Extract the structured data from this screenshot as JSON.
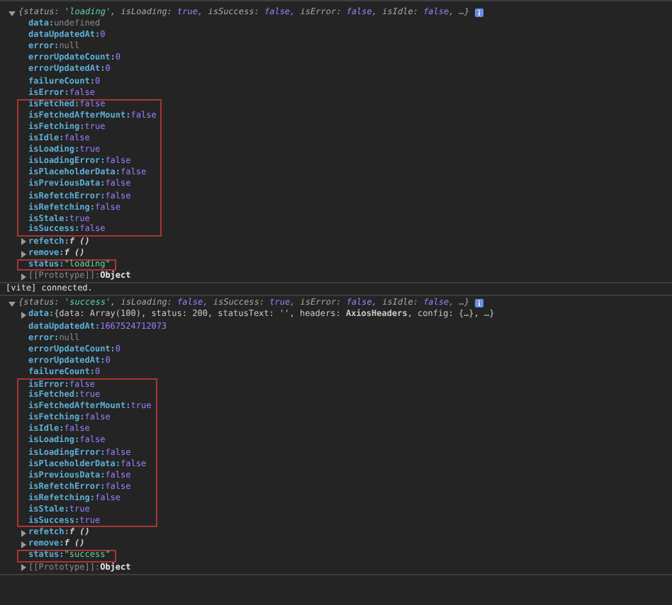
{
  "console": [
    {
      "kind": "object",
      "expanded": true,
      "summary": {
        "open": "{",
        "items": [
          {
            "key": "status:",
            "value": "'loading',",
            "kind": "string"
          },
          {
            "key": "isLoading:",
            "value": "true,",
            "kind": "boolean"
          },
          {
            "key": "isSuccess:",
            "value": "false,",
            "kind": "boolean"
          },
          {
            "key": "isError:",
            "value": "false,",
            "kind": "boolean"
          },
          {
            "key": "isIdle:",
            "value": "false,",
            "kind": "boolean"
          }
        ],
        "close": "…}"
      },
      "rows": [
        {
          "kind": "undefined",
          "key": "data:",
          "value": "undefined",
          "highlighted": false
        },
        {
          "kind": "number",
          "key": "dataUpdatedAt:",
          "value": "0",
          "highlighted": false
        },
        {
          "kind": "null",
          "key": "error:",
          "value": "null",
          "highlighted": false
        },
        {
          "kind": "number",
          "key": "errorUpdateCount:",
          "value": "0",
          "highlighted": false
        },
        {
          "kind": "number",
          "key": "errorUpdatedAt:",
          "value": "0",
          "highlighted": false
        },
        {
          "kind": "number",
          "key": "failureCount:",
          "value": "0",
          "highlighted": false
        },
        {
          "kind": "boolean",
          "key": "isError:",
          "value": "false",
          "highlighted": false
        },
        {
          "kind": "boolean",
          "key": "isFetched:",
          "value": "false",
          "highlighted": true
        },
        {
          "kind": "boolean",
          "key": "isFetchedAfterMount:",
          "value": "false",
          "highlighted": true
        },
        {
          "kind": "boolean",
          "key": "isFetching:",
          "value": "true",
          "highlighted": true
        },
        {
          "kind": "boolean",
          "key": "isIdle:",
          "value": "false",
          "highlighted": true
        },
        {
          "kind": "boolean",
          "key": "isLoading:",
          "value": "true",
          "highlighted": true
        },
        {
          "kind": "boolean",
          "key": "isLoadingError:",
          "value": "false",
          "highlighted": true
        },
        {
          "kind": "boolean",
          "key": "isPlaceholderData:",
          "value": "false",
          "highlighted": true
        },
        {
          "kind": "boolean",
          "key": "isPreviousData:",
          "value": "false",
          "highlighted": true
        },
        {
          "kind": "boolean",
          "key": "isRefetchError:",
          "value": "false",
          "highlighted": true
        },
        {
          "kind": "boolean",
          "key": "isRefetching:",
          "value": "false",
          "highlighted": true
        },
        {
          "kind": "boolean",
          "key": "isStale:",
          "value": "true",
          "highlighted": true
        },
        {
          "kind": "boolean",
          "key": "isSuccess:",
          "value": "false",
          "highlighted": true
        },
        {
          "kind": "function",
          "key": "refetch:",
          "value": "f ()",
          "highlighted": false
        },
        {
          "kind": "function",
          "key": "remove:",
          "value": "f ()",
          "highlighted": false
        },
        {
          "kind": "string",
          "key": "status:",
          "value": "\"loading\"",
          "highlighted": true
        },
        {
          "kind": "prototype",
          "key": "[[Prototype]]:",
          "value": "Object",
          "highlighted": false
        }
      ]
    },
    {
      "kind": "message",
      "text": "[vite] connected."
    },
    {
      "kind": "object",
      "expanded": true,
      "summary": {
        "open": "{",
        "items": [
          {
            "key": "status:",
            "value": "'success',",
            "kind": "string"
          },
          {
            "key": "isLoading:",
            "value": "false,",
            "kind": "boolean"
          },
          {
            "key": "isSuccess:",
            "value": "true,",
            "kind": "boolean"
          },
          {
            "key": "isError:",
            "value": "false,",
            "kind": "boolean"
          },
          {
            "key": "isIdle:",
            "value": "false,",
            "kind": "boolean"
          }
        ],
        "close": "…}"
      },
      "rows": [
        {
          "kind": "preview",
          "key": "data:",
          "value": "{data: Array(100), status: 200, statusText: '', headers: **AxiosHeaders**, config: {…}, …}",
          "highlighted": false
        },
        {
          "kind": "number",
          "key": "dataUpdatedAt:",
          "value": "1667524712073",
          "highlighted": false
        },
        {
          "kind": "null",
          "key": "error:",
          "value": "null",
          "highlighted": false
        },
        {
          "kind": "number",
          "key": "errorUpdateCount:",
          "value": "0",
          "highlighted": false
        },
        {
          "kind": "number",
          "key": "errorUpdatedAt:",
          "value": "0",
          "highlighted": false
        },
        {
          "kind": "number",
          "key": "failureCount:",
          "value": "0",
          "highlighted": false
        },
        {
          "kind": "boolean",
          "key": "isError:",
          "value": "false",
          "highlighted": true
        },
        {
          "kind": "boolean",
          "key": "isFetched:",
          "value": "true",
          "highlighted": true
        },
        {
          "kind": "boolean",
          "key": "isFetchedAfterMount:",
          "value": "true",
          "highlighted": true
        },
        {
          "kind": "boolean",
          "key": "isFetching:",
          "value": "false",
          "highlighted": true
        },
        {
          "kind": "boolean",
          "key": "isIdle:",
          "value": "false",
          "highlighted": true
        },
        {
          "kind": "boolean",
          "key": "isLoading:",
          "value": "false",
          "highlighted": true
        },
        {
          "kind": "boolean",
          "key": "isLoadingError:",
          "value": "false",
          "highlighted": true
        },
        {
          "kind": "boolean",
          "key": "isPlaceholderData:",
          "value": "false",
          "highlighted": true
        },
        {
          "kind": "boolean",
          "key": "isPreviousData:",
          "value": "false",
          "highlighted": true
        },
        {
          "kind": "boolean",
          "key": "isRefetchError:",
          "value": "false",
          "highlighted": true
        },
        {
          "kind": "boolean",
          "key": "isRefetching:",
          "value": "false",
          "highlighted": true
        },
        {
          "kind": "boolean",
          "key": "isStale:",
          "value": "true",
          "highlighted": true
        },
        {
          "kind": "boolean",
          "key": "isSuccess:",
          "value": "true",
          "highlighted": true
        },
        {
          "kind": "function",
          "key": "refetch:",
          "value": "f ()",
          "highlighted": false
        },
        {
          "kind": "function",
          "key": "remove:",
          "value": "f ()",
          "highlighted": false
        },
        {
          "kind": "string",
          "key": "status:",
          "value": "\"success\"",
          "highlighted": true
        },
        {
          "kind": "prototype",
          "key": "[[Prototype]]:",
          "value": "Object",
          "highlighted": false
        }
      ]
    }
  ]
}
